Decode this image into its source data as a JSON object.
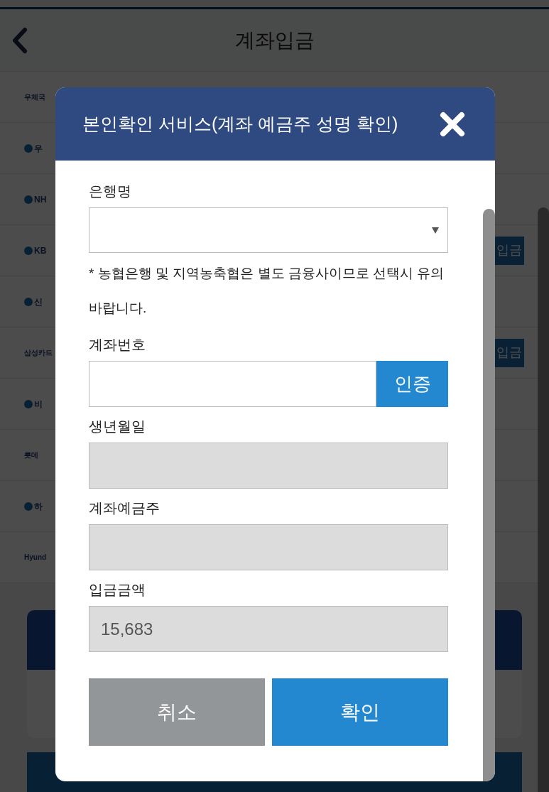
{
  "page": {
    "title": "계좌입금"
  },
  "bank_list": [
    {
      "name": "우체국",
      "kind": "text"
    },
    {
      "name": "우",
      "kind": "logo"
    },
    {
      "name": "NH",
      "kind": "logo"
    },
    {
      "name": "KB",
      "kind": "logo",
      "deposit_button": "입금"
    },
    {
      "name": "신",
      "kind": "logo"
    },
    {
      "name": "삼성카드",
      "kind": "text",
      "deposit_button": "입금"
    },
    {
      "name": "비",
      "kind": "logo"
    },
    {
      "name": "롯데",
      "kind": "text"
    },
    {
      "name": "하",
      "kind": "logo"
    },
    {
      "name": "Hyund",
      "kind": "text"
    }
  ],
  "dialog": {
    "title": "본인확인 서비스(계좌 예금주 성명 확인)",
    "fields": [
      {
        "kind": "select",
        "label": "은행명",
        "note": "* 농협은행 및 지역농축협은 별도 금융사이므로 선택시 유의 바랍니다."
      },
      {
        "kind": "input",
        "label": "계좌번호",
        "button": "인증"
      },
      {
        "kind": "readonly",
        "label": "생년월일"
      },
      {
        "kind": "readonly",
        "label": "계좌예금주"
      },
      {
        "kind": "readonly",
        "label": "입금금액",
        "value": "15,683"
      }
    ],
    "buttons": [
      {
        "label": "취소",
        "kind": "cancel"
      },
      {
        "label": "확인",
        "kind": "confirm"
      }
    ]
  }
}
